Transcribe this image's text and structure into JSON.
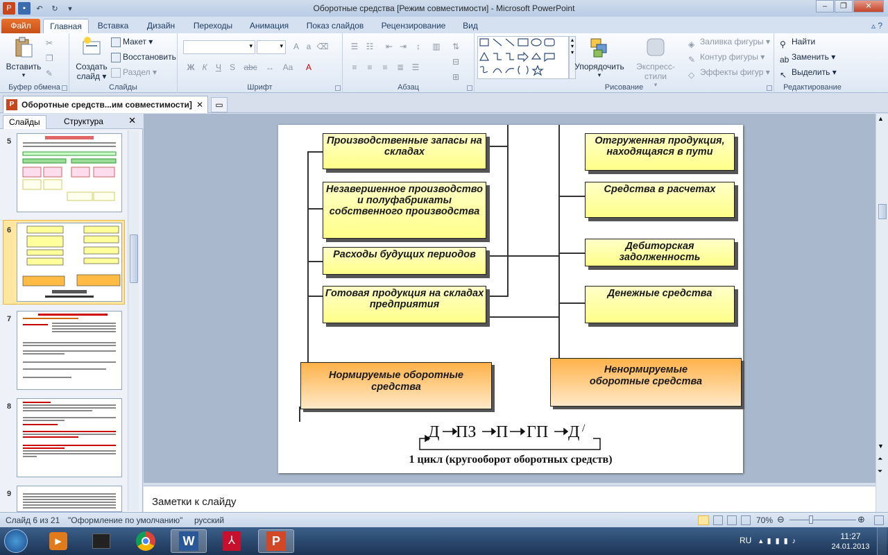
{
  "window": {
    "title": "Оборотные средства [Режим совместимости] - Microsoft PowerPoint"
  },
  "tabs": [
    "Файл",
    "Главная",
    "Вставка",
    "Дизайн",
    "Переходы",
    "Анимация",
    "Показ слайдов",
    "Рецензирование",
    "Вид"
  ],
  "ribbon": {
    "clipboard": {
      "label": "Буфер обмена",
      "paste": "Вставить"
    },
    "slides": {
      "label": "Слайды",
      "new_slide_1": "Создать",
      "new_slide_2": "слайд",
      "layout": "Макет",
      "reset": "Восстановить",
      "section": "Раздел"
    },
    "font": {
      "label": "Шрифт",
      "b": "Ж",
      "i": "К",
      "u": "Ч",
      "s": "S",
      "abc": "abc"
    },
    "paragraph": {
      "label": "Абзац"
    },
    "drawing": {
      "label": "Рисование",
      "arrange": "Упорядочить",
      "quick_styles": "Экспресс-стили",
      "fill": "Заливка фигуры",
      "outline": "Контур фигуры",
      "effects": "Эффекты фигур"
    },
    "editing": {
      "label": "Редактирование",
      "find": "Найти",
      "replace": "Заменить",
      "select": "Выделить"
    }
  },
  "doc_tab": "Оборотные средств...им совместимости]",
  "left_panel": {
    "tab_slides": "Слайды",
    "tab_outline": "Структура",
    "nums": [
      "5",
      "6",
      "7",
      "8",
      "9"
    ]
  },
  "slide": {
    "left_boxes": [
      "Производственные запасы на складах",
      "Незавершенное производство и полуфабрикаты собственного производства",
      "Расходы будущих периодов",
      "Готовая продукция на складах предприятия"
    ],
    "right_boxes": [
      "Отгруженная продукция, находящаяся в пути",
      "Средства в расчетах",
      "Дебиторская задолженность",
      "Денежные средства"
    ],
    "normed": "Нормируемые оборотные средства",
    "nonnormed": "Ненормируемые оборотные средства",
    "formula": {
      "d": "Д",
      "pz": "ПЗ",
      "p": "П",
      "gp": "ГП",
      "d2": "Д",
      "prime": "/"
    },
    "cycle": "1 цикл (кругооборот оборотных средств)"
  },
  "notes": "Заметки к слайду",
  "status": {
    "slide": "Слайд 6 из 21",
    "theme": "\"Оформление по умолчанию\"",
    "lang": "русский",
    "zoom": "70%"
  },
  "taskbar": {
    "lang": "RU",
    "time": "11:27",
    "date": "24.01.2013"
  }
}
